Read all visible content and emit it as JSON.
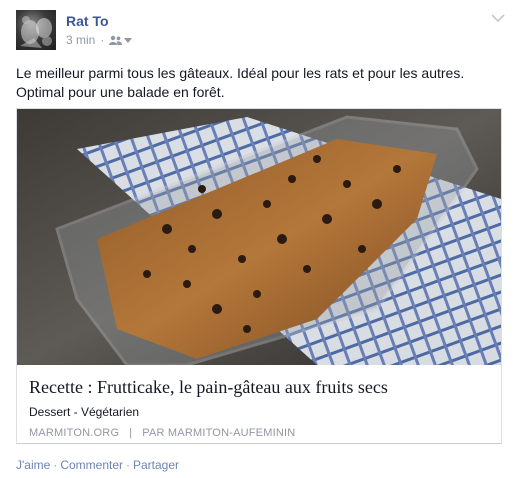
{
  "post": {
    "author": "Rat To",
    "time": "3 min",
    "audience_icon": "friends-icon",
    "message": "Le meilleur parmi tous les gâteaux. Idéal pour les rats et pour les autres. Optimal pour une balade en forêt."
  },
  "link_card": {
    "title": "Recette : Frutticake, le pain-gâteau aux fruits secs",
    "description": "Dessert - Végétarien",
    "source": "MARMITON.ORG",
    "separator": "|",
    "byline": "PAR MARMITON-AUFEMININ"
  },
  "actions": {
    "like": "J'aime",
    "comment": "Commenter",
    "share": "Partager",
    "separator": "·"
  },
  "colors": {
    "link_blue": "#3b5998",
    "action_blue": "#6d84b4",
    "meta_gray": "#9197a3"
  }
}
